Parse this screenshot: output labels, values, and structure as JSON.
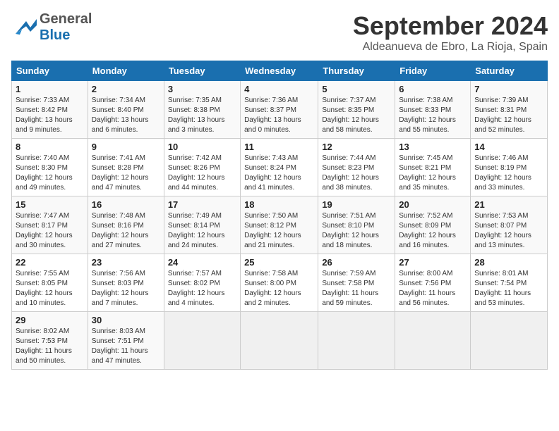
{
  "header": {
    "logo_general": "General",
    "logo_blue": "Blue",
    "month": "September 2024",
    "location": "Aldeanueva de Ebro, La Rioja, Spain"
  },
  "days_of_week": [
    "Sunday",
    "Monday",
    "Tuesday",
    "Wednesday",
    "Thursday",
    "Friday",
    "Saturday"
  ],
  "weeks": [
    [
      {
        "day": "1",
        "sunrise": "7:33 AM",
        "sunset": "8:42 PM",
        "daylight": "13 hours and 9 minutes."
      },
      {
        "day": "2",
        "sunrise": "7:34 AM",
        "sunset": "8:40 PM",
        "daylight": "13 hours and 6 minutes."
      },
      {
        "day": "3",
        "sunrise": "7:35 AM",
        "sunset": "8:38 PM",
        "daylight": "13 hours and 3 minutes."
      },
      {
        "day": "4",
        "sunrise": "7:36 AM",
        "sunset": "8:37 PM",
        "daylight": "13 hours and 0 minutes."
      },
      {
        "day": "5",
        "sunrise": "7:37 AM",
        "sunset": "8:35 PM",
        "daylight": "12 hours and 58 minutes."
      },
      {
        "day": "6",
        "sunrise": "7:38 AM",
        "sunset": "8:33 PM",
        "daylight": "12 hours and 55 minutes."
      },
      {
        "day": "7",
        "sunrise": "7:39 AM",
        "sunset": "8:31 PM",
        "daylight": "12 hours and 52 minutes."
      }
    ],
    [
      {
        "day": "8",
        "sunrise": "7:40 AM",
        "sunset": "8:30 PM",
        "daylight": "12 hours and 49 minutes."
      },
      {
        "day": "9",
        "sunrise": "7:41 AM",
        "sunset": "8:28 PM",
        "daylight": "12 hours and 47 minutes."
      },
      {
        "day": "10",
        "sunrise": "7:42 AM",
        "sunset": "8:26 PM",
        "daylight": "12 hours and 44 minutes."
      },
      {
        "day": "11",
        "sunrise": "7:43 AM",
        "sunset": "8:24 PM",
        "daylight": "12 hours and 41 minutes."
      },
      {
        "day": "12",
        "sunrise": "7:44 AM",
        "sunset": "8:23 PM",
        "daylight": "12 hours and 38 minutes."
      },
      {
        "day": "13",
        "sunrise": "7:45 AM",
        "sunset": "8:21 PM",
        "daylight": "12 hours and 35 minutes."
      },
      {
        "day": "14",
        "sunrise": "7:46 AM",
        "sunset": "8:19 PM",
        "daylight": "12 hours and 33 minutes."
      }
    ],
    [
      {
        "day": "15",
        "sunrise": "7:47 AM",
        "sunset": "8:17 PM",
        "daylight": "12 hours and 30 minutes."
      },
      {
        "day": "16",
        "sunrise": "7:48 AM",
        "sunset": "8:16 PM",
        "daylight": "12 hours and 27 minutes."
      },
      {
        "day": "17",
        "sunrise": "7:49 AM",
        "sunset": "8:14 PM",
        "daylight": "12 hours and 24 minutes."
      },
      {
        "day": "18",
        "sunrise": "7:50 AM",
        "sunset": "8:12 PM",
        "daylight": "12 hours and 21 minutes."
      },
      {
        "day": "19",
        "sunrise": "7:51 AM",
        "sunset": "8:10 PM",
        "daylight": "12 hours and 18 minutes."
      },
      {
        "day": "20",
        "sunrise": "7:52 AM",
        "sunset": "8:09 PM",
        "daylight": "12 hours and 16 minutes."
      },
      {
        "day": "21",
        "sunrise": "7:53 AM",
        "sunset": "8:07 PM",
        "daylight": "12 hours and 13 minutes."
      }
    ],
    [
      {
        "day": "22",
        "sunrise": "7:55 AM",
        "sunset": "8:05 PM",
        "daylight": "12 hours and 10 minutes."
      },
      {
        "day": "23",
        "sunrise": "7:56 AM",
        "sunset": "8:03 PM",
        "daylight": "12 hours and 7 minutes."
      },
      {
        "day": "24",
        "sunrise": "7:57 AM",
        "sunset": "8:02 PM",
        "daylight": "12 hours and 4 minutes."
      },
      {
        "day": "25",
        "sunrise": "7:58 AM",
        "sunset": "8:00 PM",
        "daylight": "12 hours and 2 minutes."
      },
      {
        "day": "26",
        "sunrise": "7:59 AM",
        "sunset": "7:58 PM",
        "daylight": "11 hours and 59 minutes."
      },
      {
        "day": "27",
        "sunrise": "8:00 AM",
        "sunset": "7:56 PM",
        "daylight": "11 hours and 56 minutes."
      },
      {
        "day": "28",
        "sunrise": "8:01 AM",
        "sunset": "7:54 PM",
        "daylight": "11 hours and 53 minutes."
      }
    ],
    [
      {
        "day": "29",
        "sunrise": "8:02 AM",
        "sunset": "7:53 PM",
        "daylight": "11 hours and 50 minutes."
      },
      {
        "day": "30",
        "sunrise": "8:03 AM",
        "sunset": "7:51 PM",
        "daylight": "11 hours and 47 minutes."
      },
      null,
      null,
      null,
      null,
      null
    ]
  ],
  "labels": {
    "sunrise": "Sunrise:",
    "sunset": "Sunset:",
    "daylight": "Daylight:"
  }
}
